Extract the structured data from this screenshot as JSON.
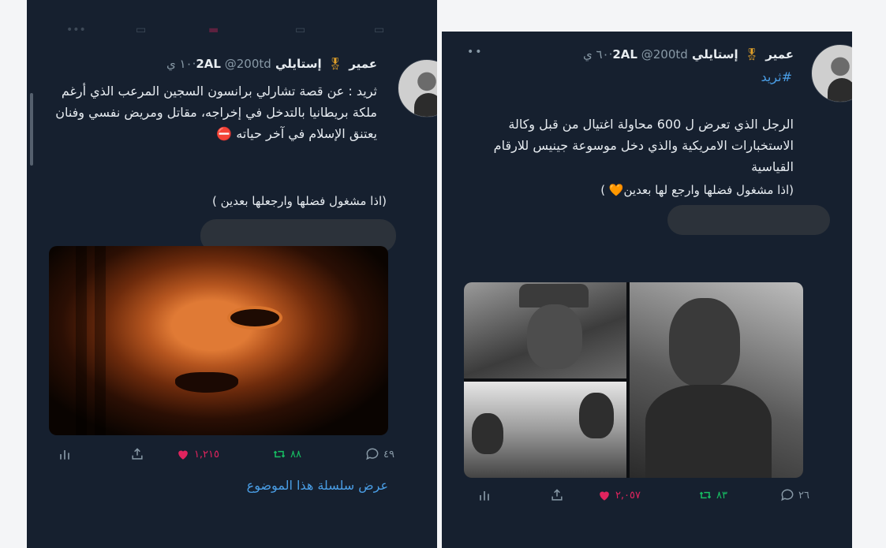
{
  "left": {
    "header": {
      "display_name": "عمير",
      "medal_icon": "medal-icon",
      "name2": "إستايلي 2AL",
      "handle": "@200td",
      "time": "١٠ ي"
    },
    "text": "ثريد : عن قصة تشارلي برانسون السجين المرعب الذي أرغم ملكة بريطانيا بالتدخل في إخراجه، مقاتل ومريض نفسي وفنان يعتنق الإسلام في آخر حياته ⛔",
    "subtext": "(اذا مشغول فضلها وارجعلها بعدين )",
    "actions": {
      "reply_count": "٤٩",
      "retweet_count": "٨٨",
      "like_count": "١,٢١٥"
    },
    "thread_link": "عرض سلسلة هذا الموضوع"
  },
  "right": {
    "header": {
      "display_name": "عمير",
      "medal_icon": "medal-icon",
      "name2": "إستايلي 2AL",
      "handle": "@200td",
      "time": "٦٠ ي"
    },
    "hashtag": "#ثريد",
    "text": "الرجل الذي تعرض ل 600 محاولة اغتيال من قبل وكالة الاستخبارات الامريكية والذي دخل موسوعة جينيس للارقام القياسية",
    "subtext": "(اذا مشغول فضلها وارجع لها بعدين🧡 )",
    "actions": {
      "reply_count": "٢٦",
      "retweet_count": "٨٣",
      "like_count": "٢,٠٥٧"
    }
  },
  "ghost_bar": {
    "more_label": "•••"
  },
  "colors": {
    "background": "#16202f",
    "text": "#e6ebf0",
    "muted": "#8899a6",
    "link": "#4a9ee6",
    "like": "#e0245e",
    "retweet": "#17bf63",
    "medal": "#e0a02a"
  }
}
